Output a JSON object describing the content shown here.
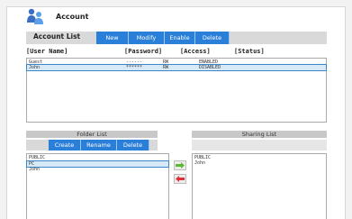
{
  "header": {
    "title": "Account"
  },
  "account_bar": {
    "label": "Account List",
    "buttons": [
      "New",
      "Modify",
      "Enable",
      "Delete"
    ]
  },
  "columns": [
    "[User Name]",
    "[Password]",
    "[Access]",
    "[Status]"
  ],
  "accounts": [
    {
      "user": "Guest",
      "password": "------",
      "access": "RW",
      "status": "ENABLED"
    },
    {
      "user": "John",
      "password": "******",
      "access": "RW",
      "status": "DISABLED"
    }
  ],
  "folder_list": {
    "title": "Folder List",
    "buttons": [
      "Create",
      "Rename",
      "Delete"
    ],
    "items": [
      "PUBLIC",
      "PC",
      "John"
    ]
  },
  "sharing_list": {
    "title": "Sharing List",
    "items": [
      "PUBLIC",
      "John"
    ]
  },
  "colors": {
    "accent": "#2a7fd9",
    "arrow_add": "#5cb82f",
    "arrow_remove": "#e0303a",
    "selection": "#3b86c9"
  },
  "icons": {
    "header": "users-icon",
    "add": "arrow-right-icon",
    "remove": "arrow-left-icon"
  }
}
